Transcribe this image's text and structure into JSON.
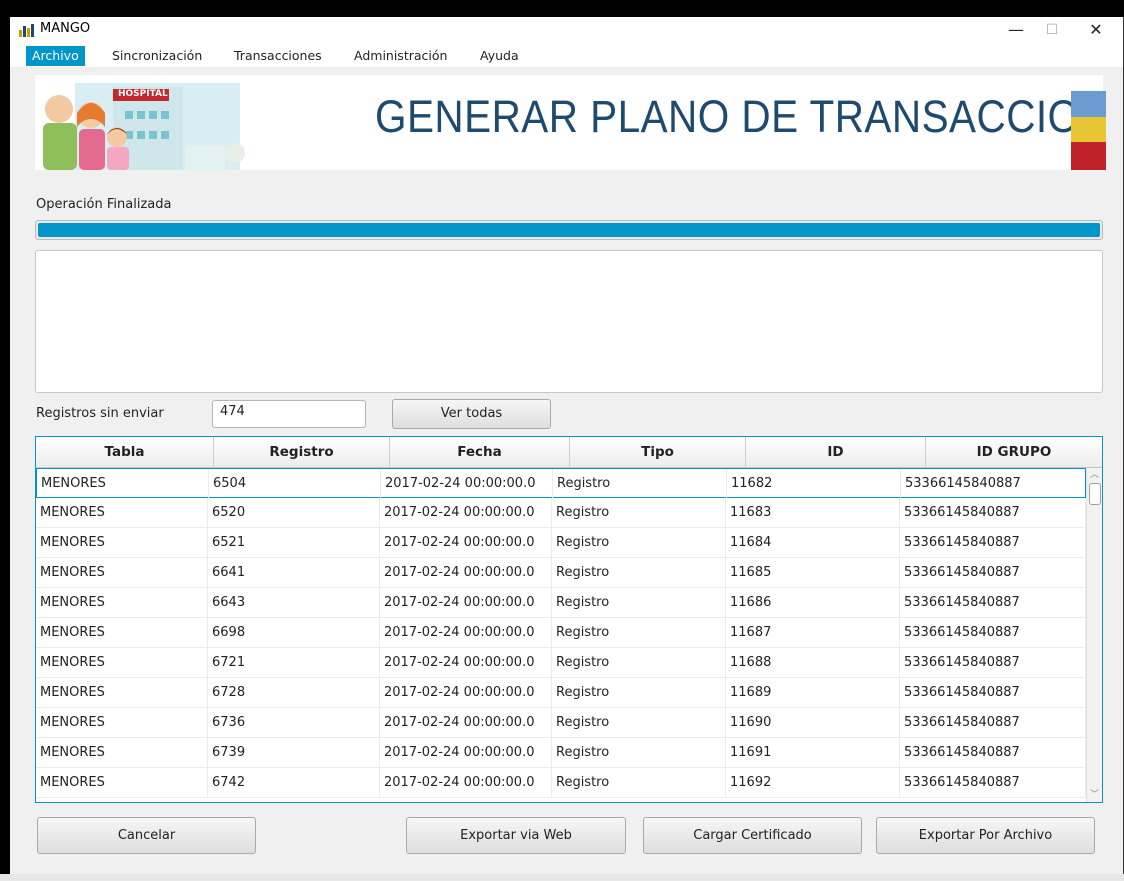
{
  "window": {
    "title": "MANGO",
    "minimize": "—",
    "maximize": "☐",
    "close": "✕"
  },
  "menu": [
    {
      "label": "Archivo",
      "active": true
    },
    {
      "label": "Sincronización"
    },
    {
      "label": "Transacciones"
    },
    {
      "label": "Administración"
    },
    {
      "label": "Ayuda"
    }
  ],
  "banner": {
    "title": "GENERAR PLANO DE TRANSACCIONES",
    "logo_sign": "HOSPITAL",
    "flag_colors": [
      "#6b9bd1",
      "#e8c533",
      "#c0222a"
    ]
  },
  "status": {
    "label": "Operación Finalizada",
    "progress": 1.0,
    "progress_color": "#0096c9"
  },
  "pending": {
    "label": "Registros sin enviar",
    "value": "474",
    "view_all": "Ver todas"
  },
  "table": {
    "columns": [
      "Tabla",
      "Registro",
      "Fecha",
      "Tipo",
      "ID",
      "ID GRUPO"
    ],
    "rows": [
      [
        "MENORES",
        "6504",
        "2017-02-24 00:00:00.0",
        "Registro",
        "11682",
        "53366145840887"
      ],
      [
        "MENORES",
        "6520",
        "2017-02-24 00:00:00.0",
        "Registro",
        "11683",
        "53366145840887"
      ],
      [
        "MENORES",
        "6521",
        "2017-02-24 00:00:00.0",
        "Registro",
        "11684",
        "53366145840887"
      ],
      [
        "MENORES",
        "6641",
        "2017-02-24 00:00:00.0",
        "Registro",
        "11685",
        "53366145840887"
      ],
      [
        "MENORES",
        "6643",
        "2017-02-24 00:00:00.0",
        "Registro",
        "11686",
        "53366145840887"
      ],
      [
        "MENORES",
        "6698",
        "2017-02-24 00:00:00.0",
        "Registro",
        "11687",
        "53366145840887"
      ],
      [
        "MENORES",
        "6721",
        "2017-02-24 00:00:00.0",
        "Registro",
        "11688",
        "53366145840887"
      ],
      [
        "MENORES",
        "6728",
        "2017-02-24 00:00:00.0",
        "Registro",
        "11689",
        "53366145840887"
      ],
      [
        "MENORES",
        "6736",
        "2017-02-24 00:00:00.0",
        "Registro",
        "11690",
        "53366145840887"
      ],
      [
        "MENORES",
        "6739",
        "2017-02-24 00:00:00.0",
        "Registro",
        "11691",
        "53366145840887"
      ],
      [
        "MENORES",
        "6742",
        "2017-02-24 00:00:00.0",
        "Registro",
        "11692",
        "53366145840887"
      ]
    ]
  },
  "actions": {
    "cancel": "Cancelar",
    "export_web": "Exportar via Web",
    "load_cert": "Cargar Certificado",
    "export_file": "Exportar Por Archivo"
  }
}
